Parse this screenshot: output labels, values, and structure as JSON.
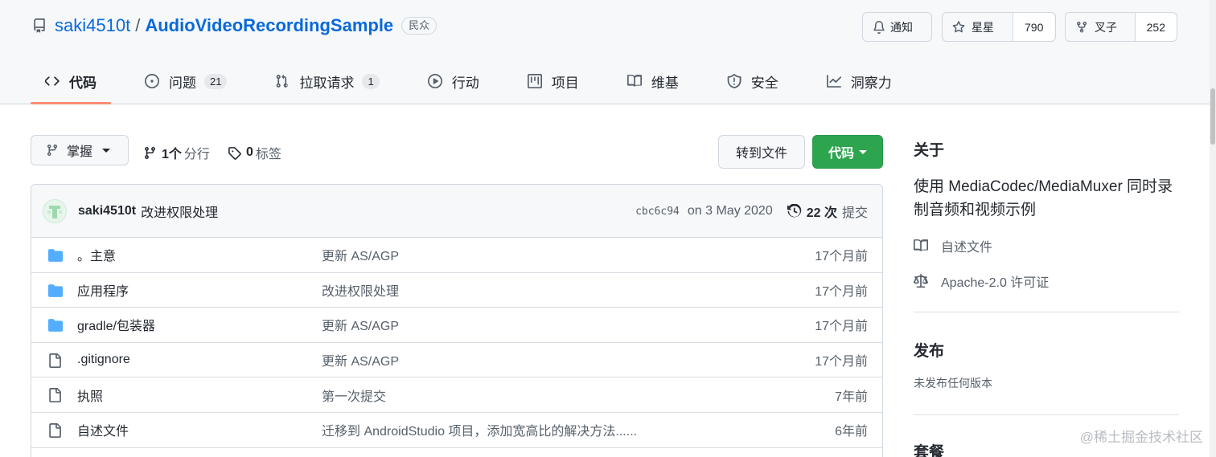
{
  "repo": {
    "owner": "saki4510t",
    "separator": "/",
    "name": "AudioVideoRecordingSample",
    "visibility": "民众"
  },
  "header_actions": {
    "watch_label": "通知",
    "star_label": "星星",
    "star_count": "790",
    "fork_label": "叉子",
    "fork_count": "252"
  },
  "tabs": [
    {
      "label": "代码",
      "icon": "code-icon",
      "active": true
    },
    {
      "label": "问题",
      "icon": "issue-icon",
      "count": "21"
    },
    {
      "label": "拉取请求",
      "icon": "pull-request-icon",
      "count": "1"
    },
    {
      "label": "行动",
      "icon": "play-icon"
    },
    {
      "label": "项目",
      "icon": "project-icon"
    },
    {
      "label": "维基",
      "icon": "book-icon"
    },
    {
      "label": "安全",
      "icon": "shield-icon"
    },
    {
      "label": "洞察力",
      "icon": "graph-icon"
    }
  ],
  "toolbar": {
    "branch_label": "掌握",
    "branches_count": "1个",
    "branches_label": "分行",
    "tags_count": "0",
    "tags_label": "标签",
    "goto_file_label": "转到文件",
    "code_button_label": "代码"
  },
  "latest_commit": {
    "author": "saki4510t",
    "message": "改进权限处理",
    "sha": "cbc6c94",
    "date": "on 3 May 2020",
    "count": "22 次",
    "count_label": "提交"
  },
  "files": [
    {
      "type": "folder",
      "name": "。主意",
      "message": "更新 AS/AGP",
      "age": "17个月前"
    },
    {
      "type": "folder",
      "name": "应用程序",
      "message": "改进权限处理",
      "age": "17个月前"
    },
    {
      "type": "folder",
      "name": "gradle/包装器",
      "message": "更新 AS/AGP",
      "age": "17个月前"
    },
    {
      "type": "file",
      "name": ".gitignore",
      "message": "更新 AS/AGP",
      "age": "17个月前"
    },
    {
      "type": "file",
      "name": "执照",
      "message": "第一次提交",
      "age": "7年前"
    },
    {
      "type": "file",
      "name": "自述文件",
      "message": "迁移到 AndroidStudio 项目，添加宽高比的解决方法......",
      "age": "6年前"
    }
  ],
  "sidebar": {
    "about_heading": "关于",
    "description": "使用 MediaCodec/MediaMuxer 同时录制音频和视频示例",
    "readme_label": "自述文件",
    "license_label": "Apache-2.0 许可证",
    "releases_heading": "发布",
    "releases_text": "未发布任何版本",
    "packages_heading": "套餐"
  },
  "watermark": "@稀土掘金技术社区",
  "colors": {
    "link": "#0969da",
    "primary_button": "#2da44e",
    "active_tab_underline": "#fd8c73",
    "folder_icon": "#54aeff"
  }
}
